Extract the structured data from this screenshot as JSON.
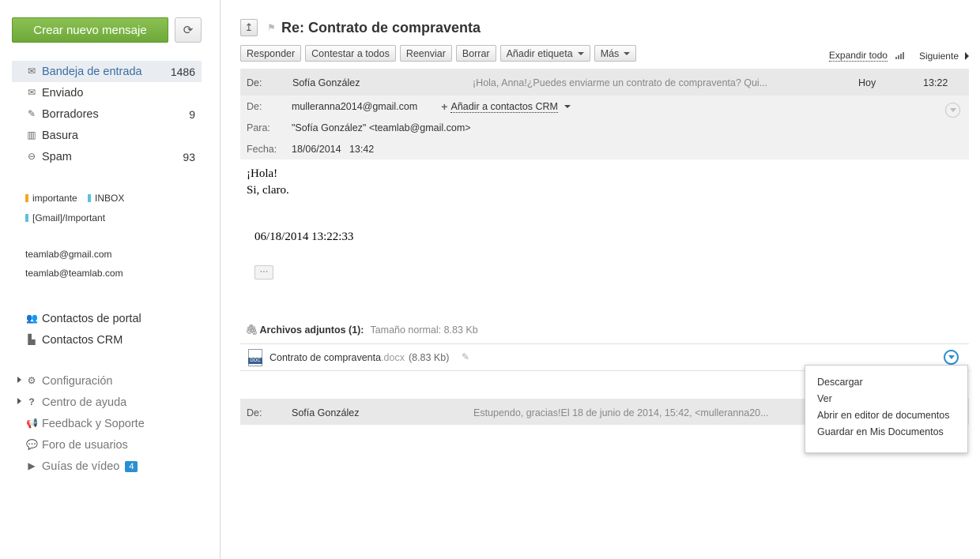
{
  "sidebar": {
    "compose_label": "Crear nuevo mensaje",
    "folders": [
      {
        "label": "Bandeja de entrada",
        "count": "1486"
      },
      {
        "label": "Enviado",
        "count": ""
      },
      {
        "label": "Borradores",
        "count": "9"
      },
      {
        "label": "Basura",
        "count": ""
      },
      {
        "label": "Spam",
        "count": "93"
      }
    ],
    "tags": [
      {
        "label": "importante",
        "color": "#f5a623"
      },
      {
        "label": "INBOX",
        "color": "#5bc0de"
      },
      {
        "label": "[Gmail]/Important",
        "color": "#5bc0de"
      }
    ],
    "accounts": [
      "teamlab@gmail.com",
      "teamlab@teamlab.com"
    ],
    "contacts": [
      {
        "label": "Contactos de portal"
      },
      {
        "label": "Contactos CRM"
      }
    ],
    "help": [
      {
        "label": "Configuración"
      },
      {
        "label": "Centro de ayuda"
      },
      {
        "label": "Feedback y Soporte"
      },
      {
        "label": "Foro de usuarios"
      },
      {
        "label": "Guías de vídeo",
        "badge": "4"
      }
    ]
  },
  "message": {
    "subject": "Re: Contrato de compraventa",
    "toolbar": {
      "reply": "Responder",
      "reply_all": "Contestar a todos",
      "forward": "Reenviar",
      "delete": "Borrar",
      "add_tag": "Añadir etiqueta",
      "more": "Más",
      "expand_all": "Expandir todo",
      "next": "Siguiente"
    },
    "first": {
      "from_label": "De:",
      "from": "Sofía González",
      "snippet": "¡Hola, Anna!¿Puedes enviarme un contrato de compraventa? Qui...",
      "day": "Hoy",
      "time": "13:22"
    },
    "header": {
      "from_label": "De:",
      "from": "mulleranna2014@gmail.com",
      "crm_label": "Añadir a contactos CRM",
      "to_label": "Para:",
      "to": "\"Sofía González\" <teamlab@gmail.com>",
      "date_label": "Fecha:",
      "date": "18/06/2014   13:42"
    },
    "body": {
      "line1": "¡Hola!",
      "line2": "Si, claro.",
      "date": "06/18/2014 13:22:33",
      "more": "···"
    },
    "attachments": {
      "title": "Archivos adjuntos (1):",
      "size": "Tamaño normal: 8.83 Kb",
      "file_name": "Contrato de compraventa",
      "file_ext": ".docx",
      "file_size": "(8.83 Kb)",
      "file_type_label": "DOC"
    },
    "last": {
      "from_label": "De:",
      "from": "Sofía González",
      "snippet": "Estupendo, gracias!El 18 de junio de 2014, 15:42, <mulleranna20..."
    }
  },
  "menu": {
    "items": [
      "Descargar",
      "Ver",
      "Abrir en editor de documentos",
      "Guardar en Mis Documentos"
    ]
  }
}
